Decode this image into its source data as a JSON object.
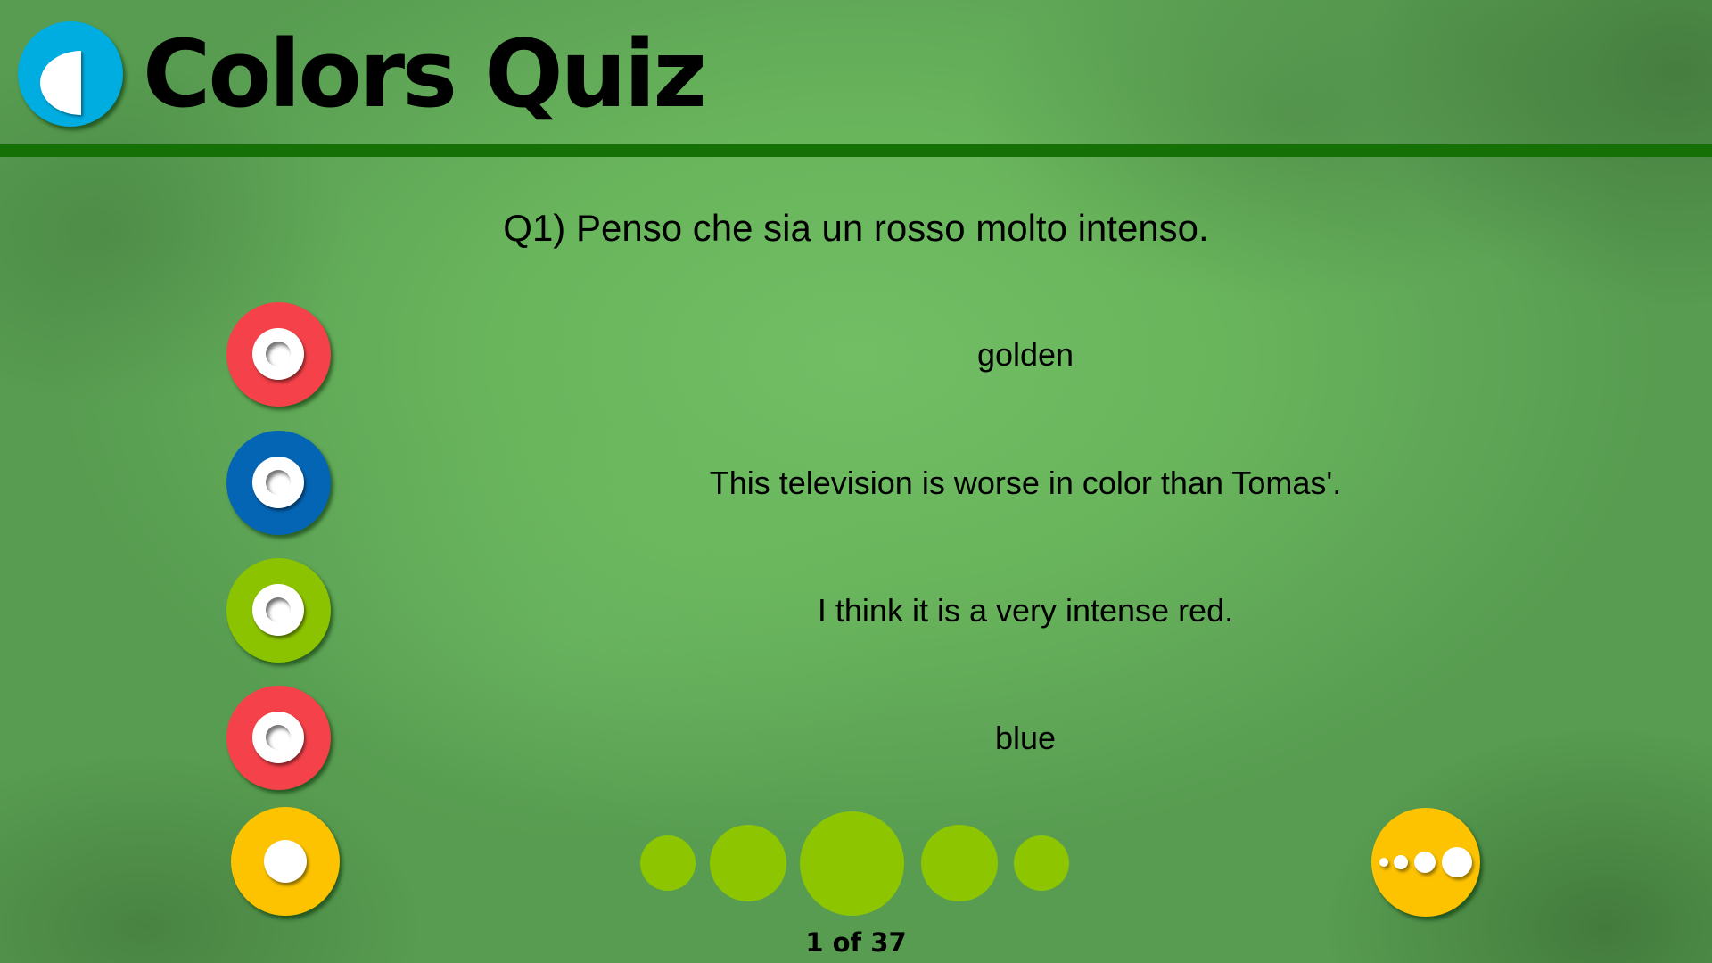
{
  "header": {
    "title": "Colors Quiz",
    "logo_icon": "half-circle-logo-icon",
    "logo_color": "#00ade0",
    "separator_color": "#157005"
  },
  "question": {
    "text": "Q1) Penso che sia un rosso molto intenso."
  },
  "answers": [
    {
      "label": "golden",
      "button_color": "#f5424a",
      "icon": "radio-ring-icon"
    },
    {
      "label": "This television is worse in color than Tomas'.",
      "button_color": "#0565b5",
      "icon": "radio-ring-icon"
    },
    {
      "label": "I think it is a very intense red.",
      "button_color": "#8cc300",
      "icon": "radio-ring-icon"
    },
    {
      "label": "blue",
      "button_color": "#f5424a",
      "icon": "radio-ring-icon"
    }
  ],
  "controls": {
    "left_button": {
      "icon": "dot-icon",
      "color": "#fdc300"
    },
    "more_button": {
      "icon": "more-dots-icon",
      "color": "#fdc300"
    }
  },
  "pager": {
    "current": 1,
    "total": 37,
    "label": "1 of 37",
    "dot_color": "#8dc600",
    "dot_count": 5
  }
}
